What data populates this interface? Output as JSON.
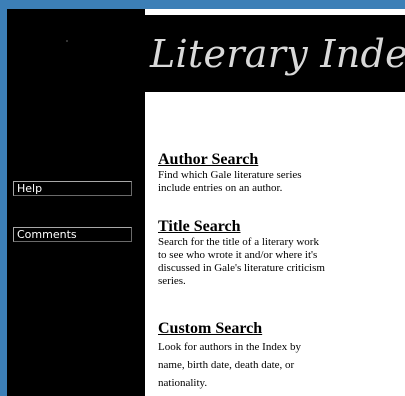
{
  "colors": {
    "window_edge": "#3c7fb7",
    "sidebar_bg": "#000000",
    "banner_bg": "#000000",
    "banner_text": "#d9d9d9",
    "content_bg": "#ffffff"
  },
  "banner": {
    "title": "Literary Index"
  },
  "sidebar": {
    "items": [
      {
        "label": "Help"
      },
      {
        "label": "Comments"
      }
    ]
  },
  "main": {
    "sections": [
      {
        "link": "Author Search",
        "lines": [
          "Find which Gale literature series",
          "include entries on an author."
        ]
      },
      {
        "link": "Title Search",
        "lines": [
          "Search for the title of a literary work",
          "to see who wrote it and/or where it's",
          "discussed in Gale's literature criticism",
          "series."
        ]
      },
      {
        "link": "Custom Search",
        "lines": [
          "Look for authors in the Index by",
          "name, birth date, death date, or",
          "nationality."
        ]
      }
    ]
  }
}
